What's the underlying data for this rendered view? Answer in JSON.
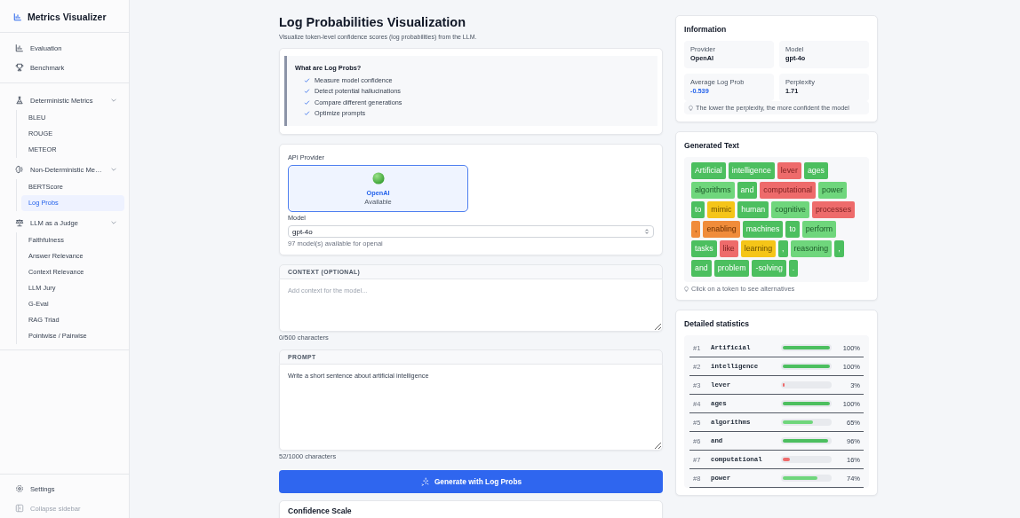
{
  "sidebar": {
    "title": "Metrics Visualizer",
    "top_items": [
      {
        "label": "Evaluation",
        "selected": false
      },
      {
        "label": "Benchmark",
        "selected": false
      }
    ],
    "groups": [
      {
        "label": "Deterministic Metrics",
        "expanded": true,
        "items": [
          {
            "label": "BLEU",
            "selected": false
          },
          {
            "label": "ROUGE",
            "selected": false
          },
          {
            "label": "METEOR",
            "selected": false
          }
        ]
      },
      {
        "label": "Non-Deterministic Me…",
        "expanded": true,
        "items": [
          {
            "label": "BERTScore",
            "selected": false
          },
          {
            "label": "Log Probs",
            "selected": true
          }
        ]
      },
      {
        "label": "LLM as a Judge",
        "expanded": true,
        "items": [
          {
            "label": "Faithfulness",
            "selected": false
          },
          {
            "label": "Answer Relevance",
            "selected": false
          },
          {
            "label": "Context Relevance",
            "selected": false
          },
          {
            "label": "LLM Jury",
            "selected": false
          },
          {
            "label": "G-Eval",
            "selected": false
          },
          {
            "label": "RAG Triad",
            "selected": false
          },
          {
            "label": "Pointwise / Pairwise",
            "selected": false
          }
        ]
      }
    ],
    "settings": "Settings",
    "collapse": "Collapse sidebar"
  },
  "page": {
    "title": "Log Probabilities Visualization",
    "subtitle": "Visualize token-level confidence scores (log probabilities) from the LLM."
  },
  "intro": {
    "heading": "What are Log Probs?",
    "points": [
      "Measure model confidence",
      "Detect potential hallucinations",
      "Compare different generations",
      "Optimize prompts"
    ]
  },
  "provider": {
    "label": "API Provider",
    "options": [
      {
        "name": "OpenAI",
        "status": "Available",
        "selected": true
      }
    ],
    "model_label": "Model",
    "model": "gpt-4o",
    "model_hint": "97 model(s) available for openai"
  },
  "context": {
    "heading": "CONTEXT (OPTIONAL)",
    "placeholder": "Add context for the model...",
    "count": "0/500 characters"
  },
  "prompt": {
    "heading": "PROMPT",
    "value": "Write a short sentence about artificial intelligence",
    "count": "52/1000 characters"
  },
  "generate_button": "Generate with Log Probs",
  "confidence_scale": {
    "title": "Confidence Scale"
  },
  "information": {
    "title": "Information",
    "fields": [
      {
        "label": "Provider",
        "value": "OpenAI",
        "kind": "plain"
      },
      {
        "label": "Model",
        "value": "gpt-4o",
        "kind": "plain"
      },
      {
        "label": "Average Log Prob",
        "value": "-0.539",
        "kind": "accent"
      },
      {
        "label": "Perplexity",
        "value": "1.71",
        "kind": "plain"
      }
    ],
    "tip": "The lower the perplexity, the more confident the model"
  },
  "generated_text": {
    "title": "Generated Text",
    "tip": "Click on a token to see alternatives",
    "tokens": [
      {
        "text": "Artificial",
        "color": "#4cbf5f"
      },
      {
        "text": "intelligence",
        "color": "#4cbf5f"
      },
      {
        "text": "lever",
        "color": "#ee6b6b"
      },
      {
        "text": "ages",
        "color": "#4cbf5f"
      },
      {
        "text": "algorithms",
        "color": "#6fd67c"
      },
      {
        "text": "and",
        "color": "#4cbf5f"
      },
      {
        "text": "computational",
        "color": "#ee6b6b"
      },
      {
        "text": "power",
        "color": "#6fd67c"
      },
      {
        "text": "to",
        "color": "#4cbf5f"
      },
      {
        "text": "mimic",
        "color": "#f5c518"
      },
      {
        "text": "human",
        "color": "#4cbf5f"
      },
      {
        "text": "cognitive",
        "color": "#6fd67c"
      },
      {
        "text": "processes",
        "color": "#ee6b6b"
      },
      {
        "text": ",",
        "color": "#f08c3a"
      },
      {
        "text": "enabling",
        "color": "#f08c3a"
      },
      {
        "text": "machines",
        "color": "#4cbf5f"
      },
      {
        "text": "to",
        "color": "#4cbf5f"
      },
      {
        "text": "perform",
        "color": "#6fd67c"
      },
      {
        "text": "tasks",
        "color": "#4cbf5f"
      },
      {
        "text": "like",
        "color": "#ee6b6b"
      },
      {
        "text": "learning",
        "color": "#f5c518"
      },
      {
        "text": ",",
        "color": "#4cbf5f"
      },
      {
        "text": "reasoning",
        "color": "#6fd67c"
      },
      {
        "text": ",",
        "color": "#4cbf5f"
      },
      {
        "text": "and",
        "color": "#4cbf5f"
      },
      {
        "text": "problem",
        "color": "#4cbf5f"
      },
      {
        "text": "-solving",
        "color": "#4cbf5f"
      },
      {
        "text": ".",
        "color": "#4cbf5f"
      }
    ]
  },
  "statistics": {
    "title": "Detailed statistics",
    "rows": [
      {
        "index": "#1",
        "token": "Artificial",
        "level": 1.0,
        "percent": "100%",
        "color": "#4cbf5f"
      },
      {
        "index": "#2",
        "token": "intelligence",
        "level": 1.0,
        "percent": "100%",
        "color": "#4cbf5f"
      },
      {
        "index": "#3",
        "token": "lever",
        "level": 0.03,
        "percent": "3%",
        "color": "#ee6b6b"
      },
      {
        "index": "#4",
        "token": "ages",
        "level": 1.0,
        "percent": "100%",
        "color": "#4cbf5f"
      },
      {
        "index": "#5",
        "token": "algorithms",
        "level": 0.65,
        "percent": "65%",
        "color": "#6fd67c"
      },
      {
        "index": "#6",
        "token": "and",
        "level": 0.96,
        "percent": "96%",
        "color": "#4cbf5f"
      },
      {
        "index": "#7",
        "token": "computational",
        "level": 0.16,
        "percent": "16%",
        "color": "#ee6b6b"
      },
      {
        "index": "#8",
        "token": "power",
        "level": 0.74,
        "percent": "74%",
        "color": "#6fd67c"
      }
    ]
  }
}
